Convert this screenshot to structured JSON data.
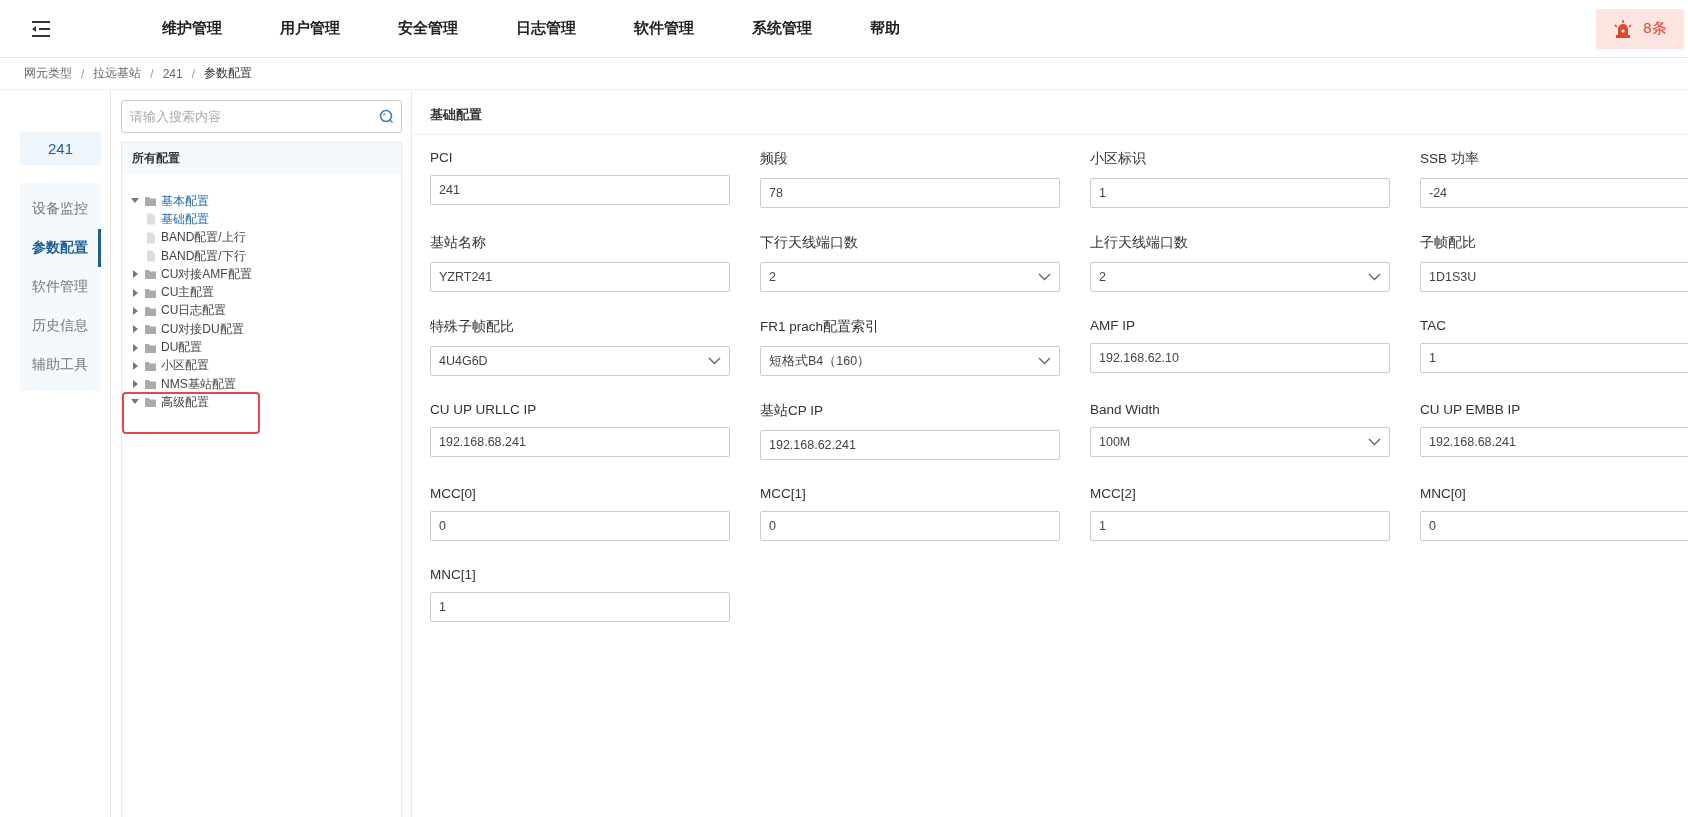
{
  "top_nav": {
    "items": [
      {
        "label": "维护管理"
      },
      {
        "label": "用户管理"
      },
      {
        "label": "安全管理"
      },
      {
        "label": "日志管理"
      },
      {
        "label": "软件管理"
      },
      {
        "label": "系统管理"
      },
      {
        "label": "帮助"
      }
    ],
    "alarm": {
      "count": "8条"
    }
  },
  "breadcrumb": {
    "items": [
      "网元类型",
      "拉远基站",
      "241",
      "参数配置"
    ],
    "separators": [
      "/",
      "/",
      "/"
    ]
  },
  "sidebar": {
    "device": "241",
    "items": [
      {
        "label": "设备监控",
        "selected": false
      },
      {
        "label": "参数配置",
        "selected": true
      },
      {
        "label": "软件管理",
        "selected": false
      },
      {
        "label": "历史信息",
        "selected": false
      },
      {
        "label": "辅助工具",
        "selected": false
      }
    ]
  },
  "tree": {
    "search": {
      "placeholder": "请输入搜索内容"
    },
    "header": "所有配置",
    "nodes": [
      {
        "label": "基本配置",
        "kind": "folder",
        "expanded": true,
        "selected": true,
        "children": [
          {
            "label": "基础配置",
            "kind": "file",
            "selected": true
          },
          {
            "label": "BAND配置/上行",
            "kind": "file",
            "selected": false
          },
          {
            "label": "BAND配置/下行",
            "kind": "file",
            "selected": false
          }
        ]
      },
      {
        "label": "CU对接AMF配置",
        "kind": "folder",
        "expanded": false,
        "selected": false
      },
      {
        "label": "CU主配置",
        "kind": "folder",
        "expanded": false,
        "selected": false
      },
      {
        "label": "CU日志配置",
        "kind": "folder",
        "expanded": false,
        "selected": false
      },
      {
        "label": "CU对接DU配置",
        "kind": "folder",
        "expanded": false,
        "selected": false
      },
      {
        "label": "DU配置",
        "kind": "folder",
        "expanded": false,
        "selected": false
      },
      {
        "label": "小区配置",
        "kind": "folder",
        "expanded": false,
        "selected": false
      },
      {
        "label": "NMS基站配置",
        "kind": "folder",
        "expanded": false,
        "selected": false
      },
      {
        "label": "高级配置",
        "kind": "folder",
        "expanded": true,
        "selected": false
      }
    ]
  },
  "form": {
    "title": "基础配置",
    "fields": [
      {
        "label": "PCI",
        "kind": "input",
        "value": "241"
      },
      {
        "label": "频段",
        "kind": "input",
        "value": "78"
      },
      {
        "label": "小区标识",
        "kind": "input",
        "value": "1"
      },
      {
        "label": "SSB 功率",
        "kind": "input",
        "value": "-24"
      },
      {
        "label": "基站名称",
        "kind": "input",
        "value": "YZRT241"
      },
      {
        "label": "下行天线端口数",
        "kind": "select",
        "value": "2"
      },
      {
        "label": "上行天线端口数",
        "kind": "select",
        "value": "2"
      },
      {
        "label": "子帧配比",
        "kind": "input",
        "value": "1D1S3U"
      },
      {
        "label": "特殊子帧配比",
        "kind": "select",
        "value": "4U4G6D"
      },
      {
        "label": "FR1 prach配置索引",
        "kind": "select",
        "value": "短格式B4（160）"
      },
      {
        "label": "AMF IP",
        "kind": "input",
        "value": "192.168.62.10"
      },
      {
        "label": "TAC",
        "kind": "input",
        "value": "1"
      },
      {
        "label": "CU UP URLLC IP",
        "kind": "input",
        "value": "192.168.68.241"
      },
      {
        "label": "基站CP IP",
        "kind": "input",
        "value": "192.168.62.241"
      },
      {
        "label": "Band Width",
        "kind": "select",
        "value": "100M"
      },
      {
        "label": "CU UP EMBB IP",
        "kind": "input",
        "value": "192.168.68.241"
      },
      {
        "label": "MCC[0]",
        "kind": "input",
        "value": "0"
      },
      {
        "label": "MCC[1]",
        "kind": "input",
        "value": "0"
      },
      {
        "label": "MCC[2]",
        "kind": "input",
        "value": "1"
      },
      {
        "label": "MNC[0]",
        "kind": "input",
        "value": "0"
      },
      {
        "label": "MNC[1]",
        "kind": "input",
        "value": "1"
      }
    ]
  }
}
